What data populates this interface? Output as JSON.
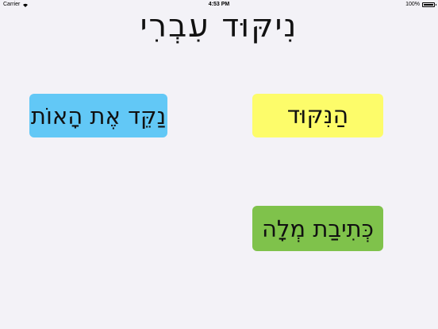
{
  "status_bar": {
    "carrier": "Carrier",
    "time": "4:53 PM",
    "battery": "100%",
    "battery_level": 1.0,
    "icons": [
      "wifi-icon",
      "battery-icon"
    ]
  },
  "title": "נִיקּוּד עִבְרִי",
  "buttons": [
    {
      "label": "הַנִּקּוּד",
      "color": "#fdfc6a"
    },
    {
      "label": "נַקֵּד אֶת הָאוֹת",
      "color": "#62c8f6"
    },
    {
      "label": "כְּתִיבַת מְלָה",
      "color": "#7fc24b"
    }
  ],
  "colors": {
    "background": "#f3f2f7",
    "accent_niqqud": "#e8322c"
  }
}
